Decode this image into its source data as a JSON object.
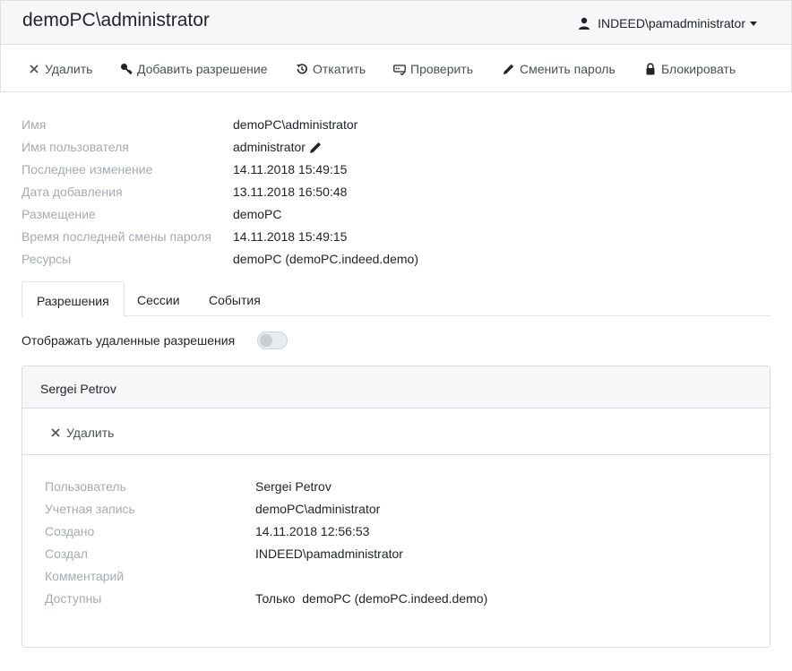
{
  "header": {
    "title": "demoPC\\administrator",
    "user": "INDEED\\pamadministrator"
  },
  "toolbar": {
    "delete": "Удалить",
    "add_permission": "Добавить разрешение",
    "rollback": "Откатить",
    "verify": "Проверить",
    "change_password": "Сменить пароль",
    "block": "Блокировать"
  },
  "properties": [
    {
      "label": "Имя",
      "value": "demoPC\\administrator"
    },
    {
      "label": "Имя пользователя",
      "value": "administrator"
    },
    {
      "label": "Последнее изменение",
      "value": "14.11.2018 15:49:15"
    },
    {
      "label": "Дата добавления",
      "value": "13.11.2018 16:50:48"
    },
    {
      "label": "Размещение",
      "value": "demoPC"
    },
    {
      "label": "Время последней смены пароля",
      "value": "14.11.2018 15:49:15"
    },
    {
      "label": "Ресурсы",
      "value": "demoPC (demoPC.indeed.demo)"
    }
  ],
  "tabs": [
    {
      "label": "Разрешения",
      "active": true
    },
    {
      "label": "Сессии",
      "active": false
    },
    {
      "label": "События",
      "active": false
    }
  ],
  "toggle": {
    "label": "Отображать удаленные разрешения",
    "on": false
  },
  "permission_card": {
    "title": "Sergei Petrov",
    "delete": "Удалить",
    "properties": [
      {
        "label": "Пользователь",
        "value": "Sergei Petrov"
      },
      {
        "label": "Учетная запись",
        "value": "demoPC\\administrator"
      },
      {
        "label": "Создано",
        "value": "14.11.2018 12:56:53"
      },
      {
        "label": "Создал",
        "value": "INDEED\\pamadministrator"
      },
      {
        "label": "Комментарий",
        "value": ""
      },
      {
        "label": "Доступны",
        "value": "Только  demoPC (demoPC.indeed.demo)"
      }
    ]
  },
  "colors": {
    "header_bg": "#f7f7f9",
    "label_gray": "#a5abb1",
    "border": "#dcdcdc"
  }
}
